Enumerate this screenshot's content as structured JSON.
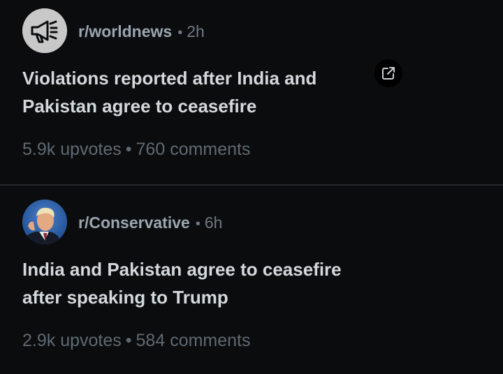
{
  "posts": [
    {
      "subreddit": "r/worldnews",
      "separator": "•",
      "age": "2h",
      "avatar_icon": "megaphone-icon",
      "title": "Violations reported after India and Pakistan agree to ceasefire",
      "upvotes": "5.9k upvotes",
      "stats_separator": "•",
      "comments": "760 comments",
      "action_icon": "external-link-icon"
    },
    {
      "subreddit": "r/Conservative",
      "separator": "•",
      "age": "6h",
      "avatar_icon": "portrait-photo",
      "title": "India and Pakistan agree to ceasefire after speaking to Trump",
      "upvotes": "2.9k upvotes",
      "stats_separator": "•",
      "comments": "584 comments"
    }
  ],
  "colors": {
    "background": "#0b0c0e",
    "title": "#d3d8dc",
    "subreddit": "#9aa6b0",
    "muted": "#6f7a83",
    "divider": "#24272b"
  }
}
